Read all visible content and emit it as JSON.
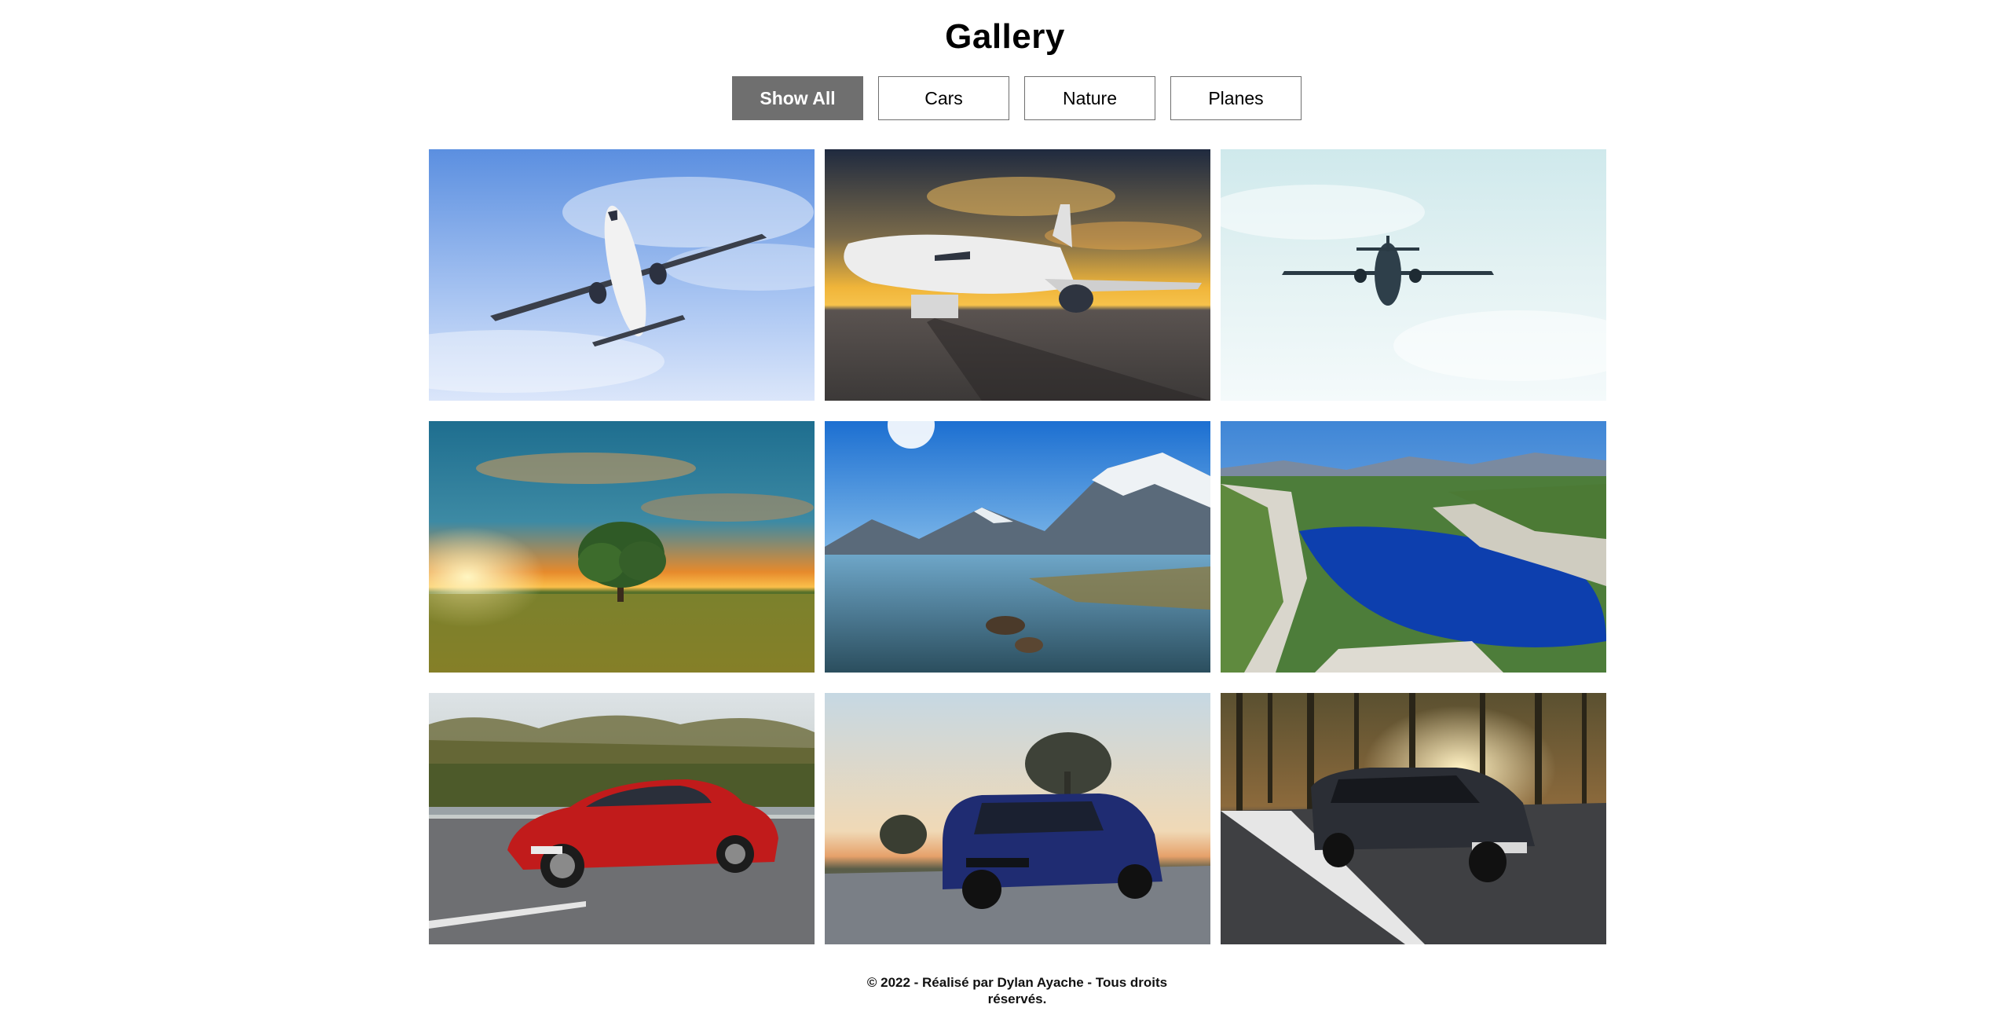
{
  "header": {
    "title": "Gallery"
  },
  "filters": [
    {
      "label": "Show All",
      "active": true
    },
    {
      "label": "Cars",
      "active": false
    },
    {
      "label": "Nature",
      "active": false
    },
    {
      "label": "Planes",
      "active": false
    }
  ],
  "gallery": {
    "items": [
      {
        "category": "Planes",
        "subject": "airliner-blue-sky"
      },
      {
        "category": "Planes",
        "subject": "airliner-on-tarmac-sunset"
      },
      {
        "category": "Planes",
        "subject": "airliner-pale-sky"
      },
      {
        "category": "Nature",
        "subject": "tree-field-sunset"
      },
      {
        "category": "Nature",
        "subject": "mountain-lake-reflection"
      },
      {
        "category": "Nature",
        "subject": "calanque-cove"
      },
      {
        "category": "Cars",
        "subject": "red-coupe"
      },
      {
        "category": "Cars",
        "subject": "blue-suv"
      },
      {
        "category": "Cars",
        "subject": "dark-sedan-forest-road"
      }
    ]
  },
  "footer": {
    "line1": "© 2022 - Réalisé par Dylan Ayache - Tous droits",
    "line2": "réservés."
  },
  "colors": {
    "active_filter_bg": "#6f6f6f",
    "button_border": "#6f6f6f",
    "background": "#ffffff"
  }
}
